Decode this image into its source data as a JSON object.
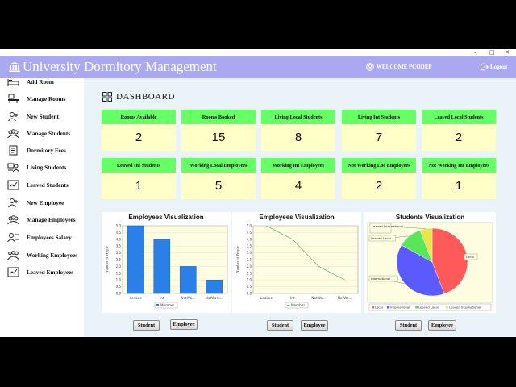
{
  "window": {
    "minimize": "–",
    "maximize": "□",
    "close": "✕"
  },
  "header": {
    "title": "University Dormitory Management",
    "welcome": "WELCOME PCODEP",
    "logout": "Logout"
  },
  "sidebar": {
    "items": [
      {
        "label": "Add Room",
        "icon": "bed-icon"
      },
      {
        "label": "Manage Rooms",
        "icon": "room-desk-icon"
      },
      {
        "label": "New Student",
        "icon": "add-user-icon"
      },
      {
        "label": "Manage Students",
        "icon": "group-icon"
      },
      {
        "label": "Dormitory Fees",
        "icon": "fees-document-icon"
      },
      {
        "label": "Living Students",
        "icon": "students-icon"
      },
      {
        "label": "Leaved Students",
        "icon": "leave-chart-icon"
      },
      {
        "label": "New Employee",
        "icon": "add-user-icon"
      },
      {
        "label": "Manage Employees",
        "icon": "group-icon"
      },
      {
        "label": "Employees Salary",
        "icon": "salary-icon"
      },
      {
        "label": "Working Employees",
        "icon": "team-icon"
      },
      {
        "label": "Leaved Employees",
        "icon": "leave-chart-icon"
      }
    ]
  },
  "dashboard": {
    "title": "DASHBOARD",
    "cards_row1": [
      {
        "label": "Rooms Available",
        "value": "2"
      },
      {
        "label": "Rooms Booked",
        "value": "15"
      },
      {
        "label": "Living Local Students",
        "value": "8"
      },
      {
        "label": "Living Int Students",
        "value": "7"
      },
      {
        "label": "Leaved Local Students",
        "value": "2"
      }
    ],
    "cards_row2": [
      {
        "label": "Leaved Int Students",
        "value": "1"
      },
      {
        "label": "Working Local Employees",
        "value": "5"
      },
      {
        "label": "Working Int Employees",
        "value": "4"
      },
      {
        "label": "Not Working Loc Employees",
        "value": "2"
      },
      {
        "label": "Not Working Int Employees",
        "value": "1"
      }
    ]
  },
  "buttons": {
    "chart1": {
      "student": "Student",
      "employee": "Employee"
    },
    "chart2": {
      "student": "Student",
      "employee": "Employee"
    },
    "chart3": {
      "student": "Student",
      "employee": "Employee"
    }
  },
  "colors": {
    "header": "#a9a8f0",
    "card_head": "#66ff66",
    "card_body": "#ffffc8",
    "bar": "#2a7fe8",
    "line": "#6fb07a",
    "plot_bg": "#fffde0"
  },
  "chart_data": [
    {
      "type": "bar",
      "title": "Employees Visualization",
      "ylabel": "Number of People",
      "xlabel": "",
      "categories": [
        "LeaLoc",
        "Int",
        "NotWo...",
        "NotWork..."
      ],
      "series": [
        {
          "name": "Member",
          "values": [
            5,
            4,
            2,
            1
          ]
        }
      ],
      "yticks": [
        "0.0",
        "0.5",
        "1.0",
        "1.5",
        "2.0",
        "2.5",
        "3.0",
        "3.5",
        "4.0",
        "4.5",
        "5.0"
      ],
      "ylim": [
        0,
        5.0
      ],
      "legend": "bottom"
    },
    {
      "type": "line",
      "title": "Employees Visualization",
      "ylabel": "Number of People",
      "xlabel": "",
      "categories": [
        "LeaLoc",
        "Int",
        "NotWo...",
        "NotWo..."
      ],
      "series": [
        {
          "name": "Member",
          "values": [
            5,
            4,
            2,
            1
          ]
        }
      ],
      "yticks": [
        "0.0",
        "0.5",
        "1.0",
        "1.5",
        "2.0",
        "2.5",
        "3.0",
        "3.5",
        "4.0",
        "4.5",
        "5.0"
      ],
      "ylim": [
        0,
        5.0
      ],
      "legend": "bottom"
    },
    {
      "type": "pie",
      "title": "Students Visualization",
      "slices": [
        {
          "label": "Local",
          "value": 8,
          "color": "#ff5a5a"
        },
        {
          "label": "International",
          "value": 7,
          "color": "#5a5aff"
        },
        {
          "label": "Leaved Local",
          "value": 2,
          "color": "#5ae65a"
        },
        {
          "label": "Leaved International",
          "value": 1,
          "color": "#e6e64a"
        }
      ],
      "legend": "bottom"
    }
  ]
}
